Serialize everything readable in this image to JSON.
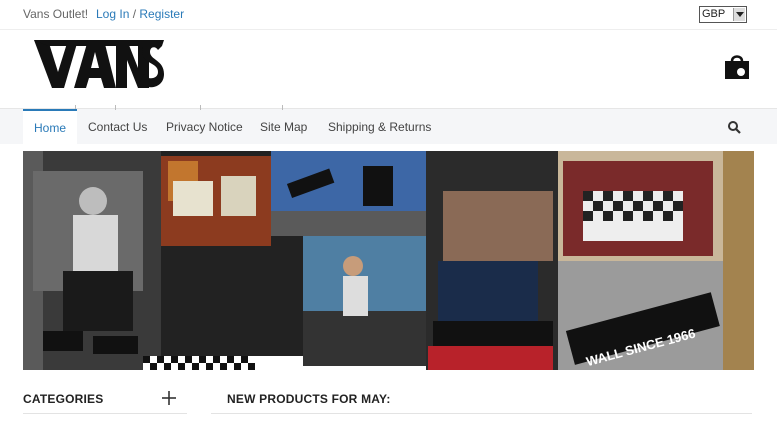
{
  "topbar": {
    "welcome": "Vans Outlet!",
    "login": "Log In",
    "separator": " / ",
    "register": "Register",
    "currency": "GBP"
  },
  "logo": {
    "text": "VANS",
    "icon": "vans-logo"
  },
  "cart": {
    "count": "0",
    "icon": "shopping-bag-icon"
  },
  "nav": {
    "items": [
      {
        "label": "Home"
      },
      {
        "label": "Contact Us"
      },
      {
        "label": "Privacy Notice"
      },
      {
        "label": "Site Map"
      },
      {
        "label": "Shipping & Returns"
      }
    ],
    "search_icon": "search-icon"
  },
  "banner": {
    "image": "collage-of-vans-sneakers-photos",
    "caption": "WALL SINCE 1966"
  },
  "sidebar": {
    "title": "CATEGORIES",
    "toggle_icon": "plus-icon"
  },
  "main": {
    "title": "NEW PRODUCTS FOR MAY:"
  },
  "colors": {
    "accent": "#2a7ab8",
    "nav_bg": "#f5f6f8"
  }
}
